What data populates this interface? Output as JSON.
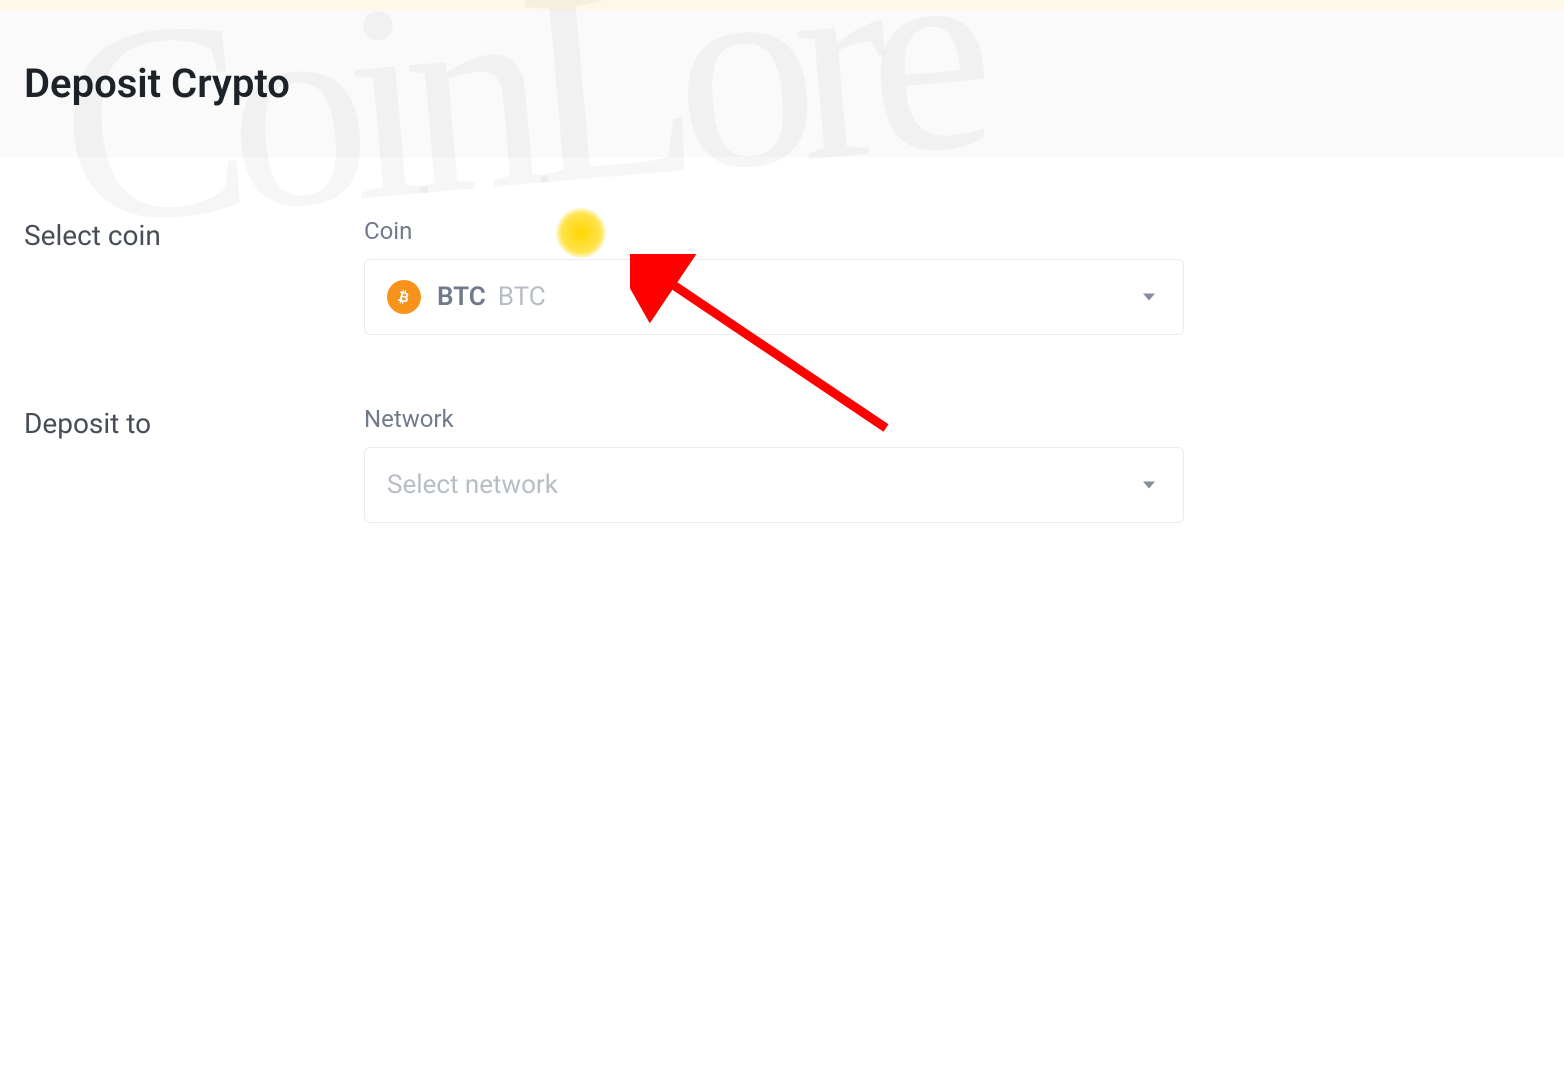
{
  "header": {
    "title": "Deposit Crypto"
  },
  "form": {
    "coin": {
      "row_label": "Select coin",
      "field_label": "Coin",
      "selected_symbol": "BTC",
      "selected_name": "BTC",
      "icon_name": "bitcoin-icon"
    },
    "network": {
      "row_label": "Deposit to",
      "field_label": "Network",
      "placeholder": "Select network"
    }
  },
  "watermark_text": "CoinLore",
  "colors": {
    "bitcoin_orange": "#f7931a",
    "header_bg": "#fafafa",
    "border": "#eaecef",
    "text_primary": "#1e2329",
    "text_secondary": "#474d57",
    "text_muted": "#707a8a",
    "text_placeholder": "#b7bdc6",
    "annotation_red": "#ff0000",
    "highlight_yellow": "#ffd500"
  }
}
